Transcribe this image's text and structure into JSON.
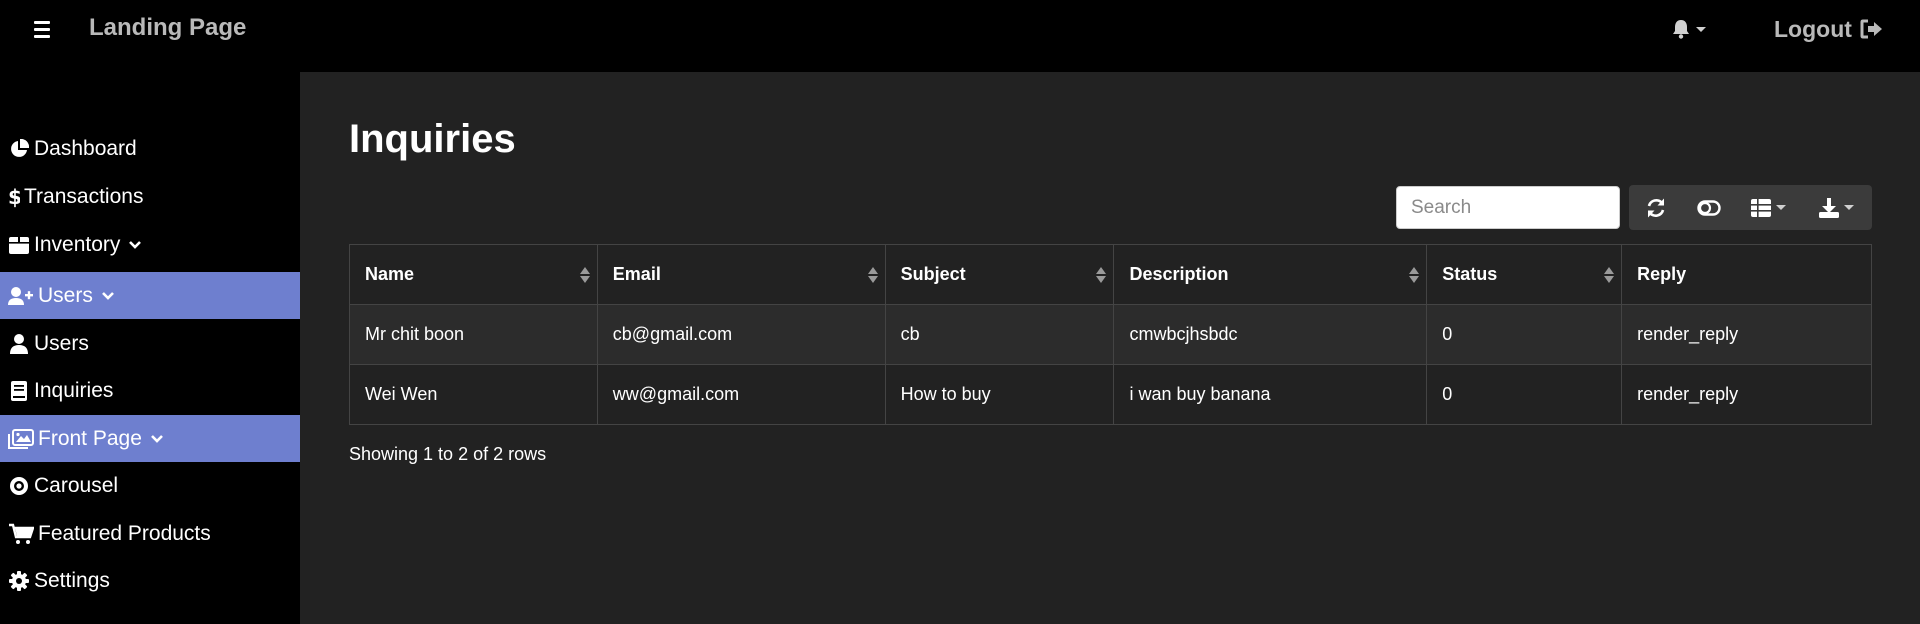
{
  "navbar": {
    "brand": "Landing Page",
    "logout_label": "Logout"
  },
  "sidebar": {
    "items": [
      {
        "label": "Dashboard",
        "icon": "pie-chart-icon"
      },
      {
        "label": "Transactions",
        "icon": "dollar-icon"
      },
      {
        "label": "Inventory",
        "icon": "box-icon"
      },
      {
        "label": "Users",
        "icon": "user-plus-icon"
      },
      {
        "label": "Users",
        "icon": "user-icon"
      },
      {
        "label": "Inquiries",
        "icon": "book-icon"
      },
      {
        "label": "Front Page",
        "icon": "images-icon"
      },
      {
        "label": "Carousel",
        "icon": "compact-disc-icon"
      },
      {
        "label": "Featured Products",
        "icon": "cart-icon"
      },
      {
        "label": "Settings",
        "icon": "gear-icon"
      }
    ]
  },
  "page": {
    "title": "Inquiries"
  },
  "toolbar": {
    "search_placeholder": "Search"
  },
  "table": {
    "columns": [
      "Name",
      "Email",
      "Subject",
      "Description",
      "Status",
      "Reply"
    ],
    "rows": [
      [
        "Mr chit boon",
        "cb@gmail.com",
        "cb",
        "cmwbcjhsbdc",
        "0",
        "render_reply"
      ],
      [
        "Wei Wen",
        "ww@gmail.com",
        "How to buy",
        "i wan buy banana",
        "0",
        "render_reply"
      ]
    ]
  },
  "pagination": {
    "summary": "Showing 1 to 2 of 2 rows"
  },
  "colors": {
    "sidebar_active": "#6e7fcf",
    "main_bg": "#222222",
    "topbar_bg": "#000000"
  }
}
